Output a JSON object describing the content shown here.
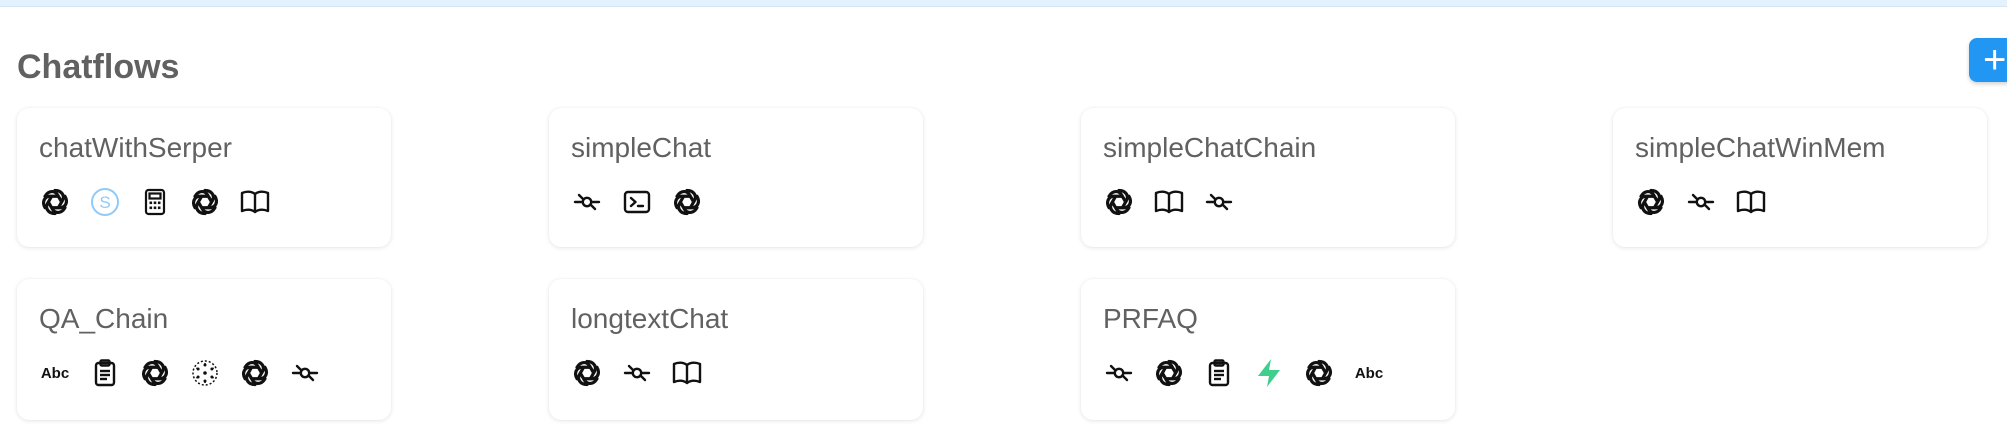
{
  "page": {
    "title": "Chatflows",
    "add_button": "+"
  },
  "colors": {
    "accent": "#2196f3",
    "title_text": "#616161",
    "serper": "#90caf9",
    "supabase": "#3ecf8e"
  },
  "cards": [
    {
      "name": "chatWithSerper",
      "icons": [
        "openai-icon",
        "serper-icon",
        "calculator-icon",
        "openai-icon",
        "book-icon"
      ]
    },
    {
      "name": "simpleChat",
      "icons": [
        "chain-icon",
        "terminal-icon",
        "openai-icon"
      ]
    },
    {
      "name": "simpleChatChain",
      "icons": [
        "openai-icon",
        "book-icon",
        "chain-icon"
      ]
    },
    {
      "name": "simpleChatWinMem",
      "icons": [
        "openai-icon",
        "chain-icon",
        "book-icon"
      ]
    },
    {
      "name": "QA_Chain",
      "icons": [
        "text-splitter-icon",
        "clipboard-icon",
        "openai-icon",
        "embeddings-icon",
        "openai-icon",
        "chain-icon"
      ]
    },
    {
      "name": "longtextChat",
      "icons": [
        "openai-icon",
        "chain-icon",
        "book-icon"
      ]
    },
    {
      "name": "PRFAQ",
      "icons": [
        "chain-icon",
        "openai-icon",
        "clipboard-icon",
        "supabase-icon",
        "openai-icon",
        "text-splitter-icon"
      ]
    }
  ],
  "text_splitter_label": "Abc"
}
